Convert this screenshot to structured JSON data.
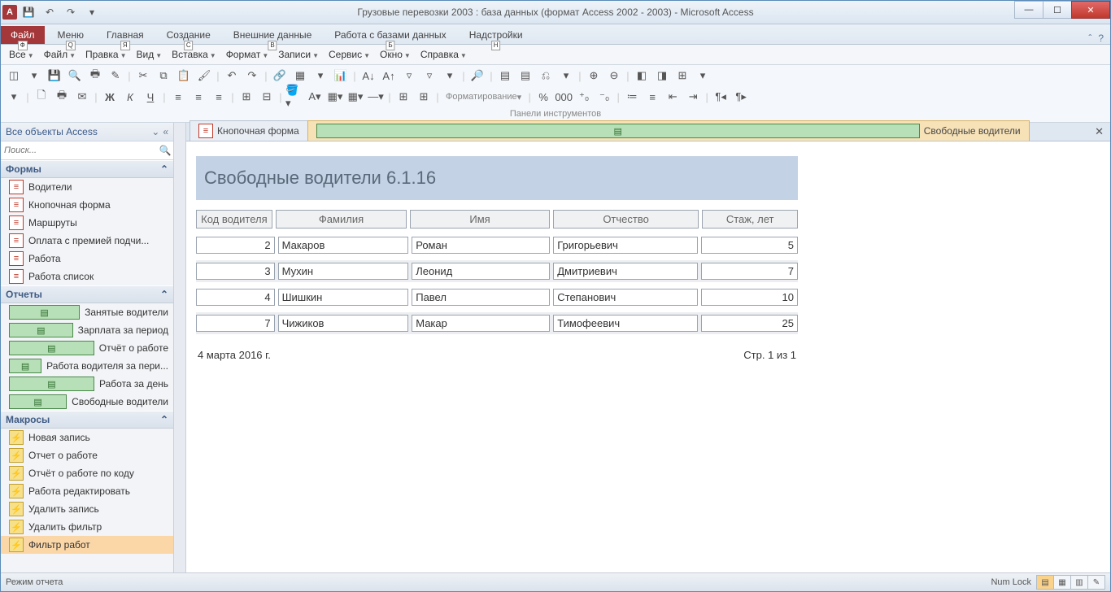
{
  "title": "Грузовые перевозки 2003 : база данных (формат Access 2002 - 2003)  -  Microsoft Access",
  "qat_keys": [
    "1",
    "2",
    "3"
  ],
  "ribbon": {
    "file": {
      "label": "Файл",
      "key": "Ф"
    },
    "tabs": [
      {
        "label": "Меню",
        "key": "Q"
      },
      {
        "label": "Главная",
        "key": "Я"
      },
      {
        "label": "Создание",
        "key": "С"
      },
      {
        "label": "Внешние данные",
        "key": "В"
      },
      {
        "label": "Работа с базами данных",
        "key": "Б"
      },
      {
        "label": "Надстройки",
        "key": "Н"
      }
    ]
  },
  "menubar": [
    {
      "label": "Все",
      "dd": true
    },
    {
      "label": "Файл",
      "dd": true
    },
    {
      "label": "Правка",
      "dd": true
    },
    {
      "label": "Вид",
      "dd": true
    },
    {
      "label": "Вставка",
      "dd": true
    },
    {
      "label": "Формат",
      "dd": true
    },
    {
      "label": "Записи",
      "dd": true
    },
    {
      "label": "Сервис",
      "dd": true
    },
    {
      "label": "Окно",
      "dd": true
    },
    {
      "label": "Справка",
      "dd": true
    }
  ],
  "panel_label": "Панели инструментов",
  "format_placeholder": "Форматирование",
  "nav": {
    "header": "Все объекты Access",
    "search_placeholder": "Поиск...",
    "groups": [
      {
        "title": "Формы",
        "type": "form",
        "items": [
          "Водители",
          "Кнопочная форма",
          "Маршруты",
          "Оплата с премией подчи...",
          "Работа",
          "Работа список"
        ]
      },
      {
        "title": "Отчеты",
        "type": "report",
        "items": [
          "Занятые водители",
          "Зарплата за период",
          "Отчёт о работе",
          "Работа водителя за пери...",
          "Работа за день",
          "Свободные водители"
        ]
      },
      {
        "title": "Макросы",
        "type": "macro",
        "items": [
          "Новая запись",
          "Отчет о работе",
          "Отчёт о работе по коду",
          "Работа редактировать",
          "Удалить запись",
          "Удалить фильтр",
          "Фильтр работ"
        ]
      }
    ]
  },
  "doctabs": [
    {
      "label": "Кнопочная форма",
      "icon": "form",
      "active": false
    },
    {
      "label": "Свободные водители",
      "icon": "report",
      "active": true
    }
  ],
  "report": {
    "title": "Свободные водители  6.1.16",
    "headers": [
      "Код водителя",
      "Фамилия",
      "Имя",
      "Отчество",
      "Стаж, лет"
    ],
    "rows": [
      {
        "id": "2",
        "f": "Макаров",
        "n": "Роман",
        "o": "Григорьевич",
        "s": "5"
      },
      {
        "id": "3",
        "f": "Мухин",
        "n": "Леонид",
        "o": "Дмитриевич",
        "s": "7"
      },
      {
        "id": "4",
        "f": "Шишкин",
        "n": "Павел",
        "o": "Степанович",
        "s": "10"
      },
      {
        "id": "7",
        "f": "Чижиков",
        "n": "Макар",
        "o": "Тимофеевич",
        "s": "25"
      }
    ],
    "date": "4 марта 2016 г.",
    "page": "Стр. 1 из 1"
  },
  "status": {
    "left": "Режим отчета",
    "numlock": "Num Lock"
  }
}
